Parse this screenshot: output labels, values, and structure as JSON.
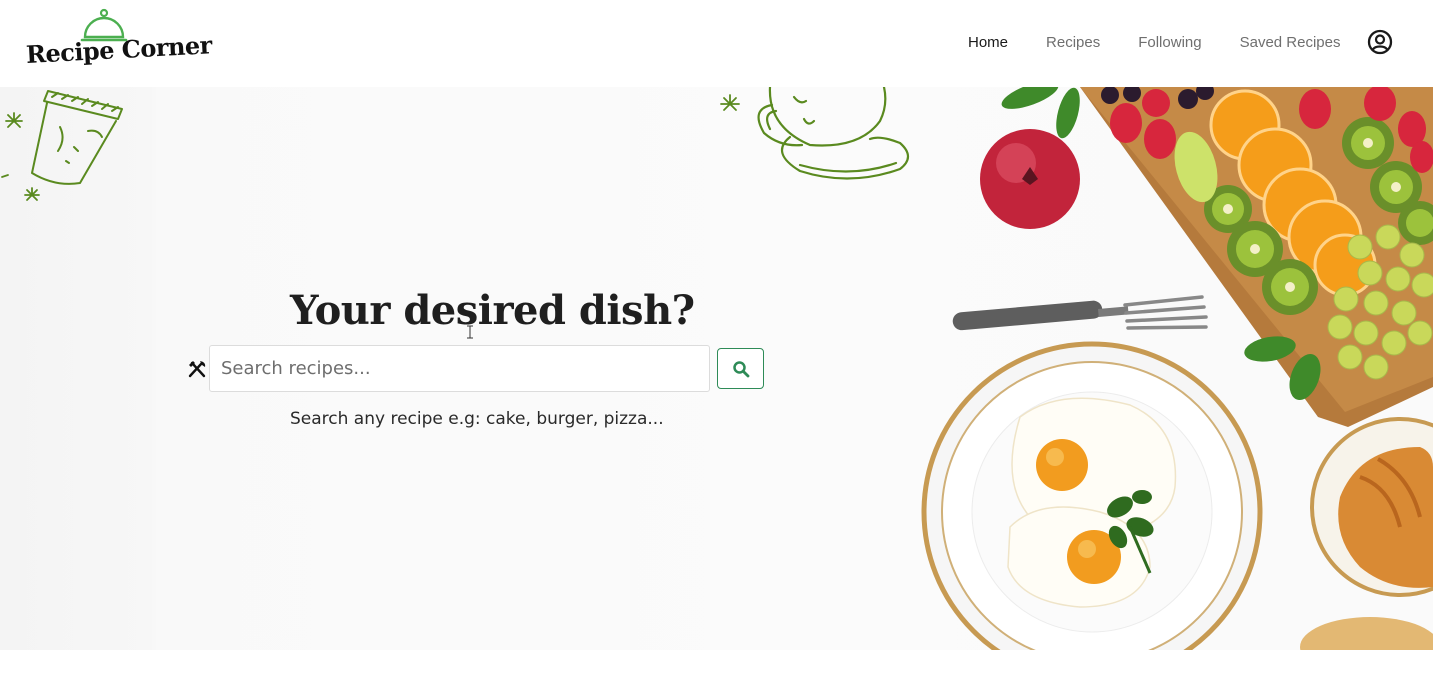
{
  "brand": {
    "name": "Recipe Corner",
    "accent_color": "#4caf50",
    "logo_icon": "cloche-icon"
  },
  "nav": {
    "items": [
      {
        "label": "Home",
        "active": true
      },
      {
        "label": "Recipes",
        "active": false
      },
      {
        "label": "Following",
        "active": false
      },
      {
        "label": "Saved Recipes",
        "active": false
      }
    ],
    "profile_icon": "user-circle-icon"
  },
  "hero": {
    "title": "Your desired dish?",
    "search": {
      "placeholder": "Search recipes...",
      "value": "",
      "leading_icon": "utensils-icon",
      "button_icon": "search-icon",
      "button_color": "#2e8b57"
    },
    "hint": "Search any recipe e.g: cake, burger, pizza..."
  }
}
